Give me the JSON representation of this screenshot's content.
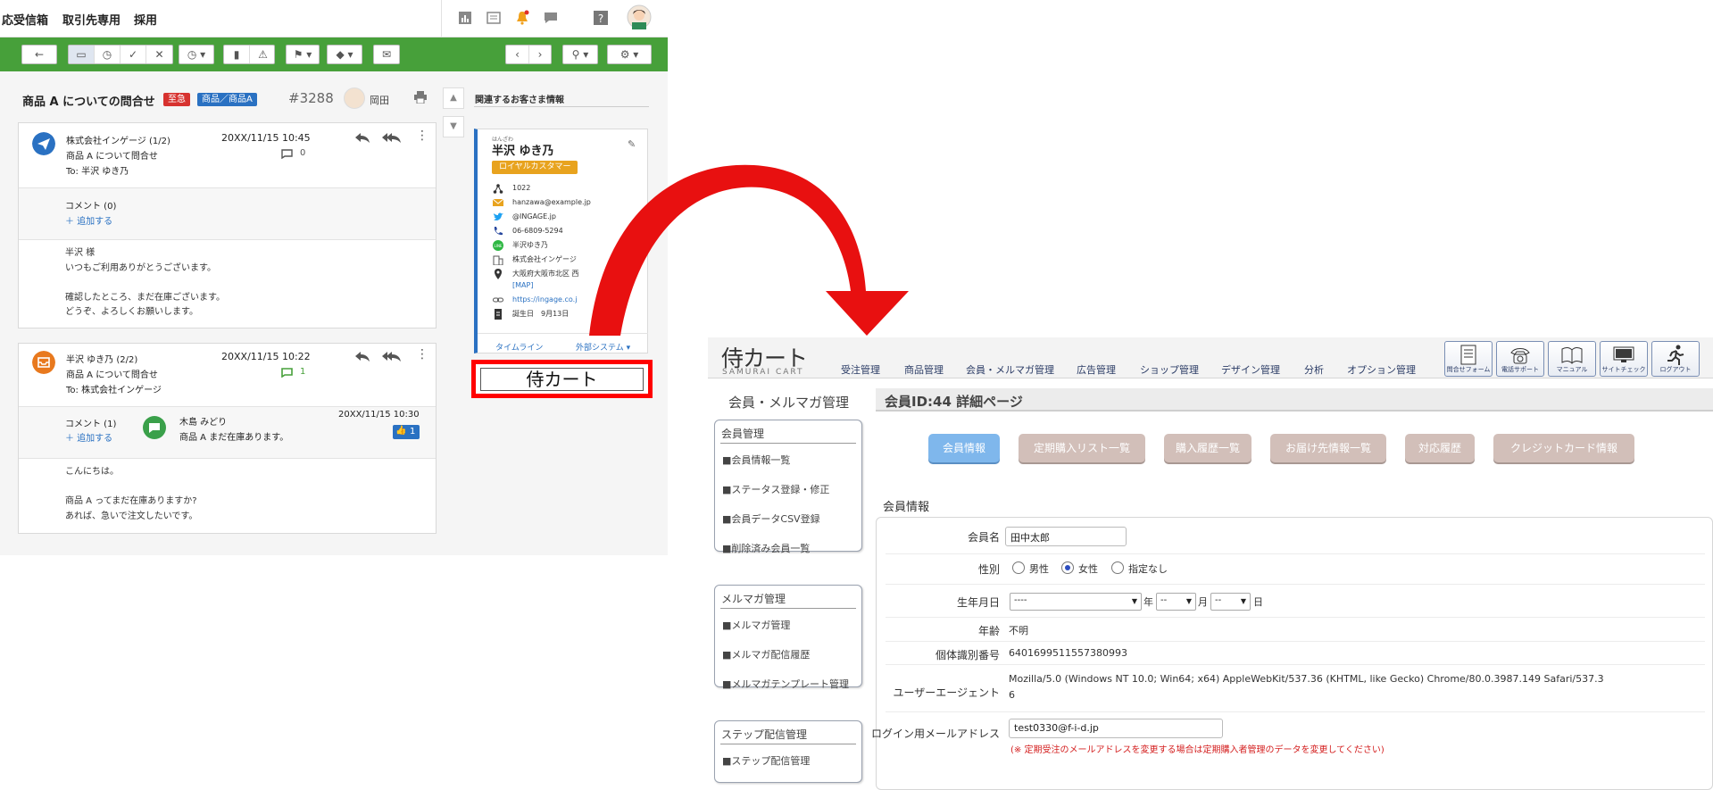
{
  "ingage": {
    "tabs": [
      "応受信箱",
      "取引先専用",
      "採用"
    ],
    "subject": "商品 A についての問合せ",
    "tags": [
      {
        "label": "至急",
        "color": "#d7322f"
      },
      {
        "label": "商品／商品A",
        "color": "#2a71c2"
      }
    ],
    "ticket_no": "#3288",
    "assignee": "岡田",
    "messages": [
      {
        "from": "株式会社インゲージ (1/2)",
        "subject": "商品 A について問合せ",
        "to": "To: 半沢 ゆき乃",
        "time": "20XX/11/15 10:45",
        "comment_count": "0",
        "comment_label": "コメント (0)",
        "add_label": "＋ 追加する",
        "body": "半沢 様\nいつもご利用ありがとうございます。\n\n確認したところ、まだ在庫ございます。\nどうぞ、よろしくお願いします。"
      },
      {
        "from": "半沢 ゆき乃 (2/2)",
        "subject": "商品 A について問合せ",
        "to": "To: 株式会社インゲージ",
        "time": "20XX/11/15 10:22",
        "comment_count": "1",
        "comment_label": "コメント (1)",
        "add_label": "＋ 追加する",
        "commenter": "木島 みどり",
        "comment_text": "商品 A まだ在庫あります。",
        "comment_time": "20XX/11/15 10:30",
        "like_count": "1",
        "body": "こんにちは。\n\n商品 A ってまだ在庫ありますか?\nあれば、急いで注文したいです。"
      }
    ],
    "related_title": "関連するお客さま情報",
    "customer": {
      "ruby": "はんざわ",
      "name": "半沢 ゆき乃",
      "badge": "ロイヤルカスタマー",
      "rows": [
        "1022",
        "hanzawa@example.jp",
        "@INGAGE.jp",
        "06-6809-5294",
        "半沢ゆき乃",
        "株式会社インゲージ",
        "大阪府大阪市北区 西",
        "[MAP]",
        "https://ingage.co.j",
        "誕生日　9月13日"
      ],
      "tab_timeline": "タイムライン",
      "tab_external": "外部システム ▾"
    },
    "samurai_link": "侍カート"
  },
  "samurai": {
    "logo": "侍カート",
    "logo_sub": "SAMURAI CART",
    "nav": [
      "受注管理",
      "商品管理",
      "会員・メルマガ管理",
      "広告管理",
      "ショップ管理",
      "デザイン管理",
      "分析",
      "オプション管理"
    ],
    "icon_buttons": [
      "問合せフォーム",
      "電話サポート",
      "マニュアル",
      "サイトチェック",
      "ログアウト"
    ],
    "side_title": "会員・メルマガ管理",
    "side_boxes": [
      {
        "title": "会員管理",
        "items": [
          "■会員情報一覧",
          "■ステータス登録・修正",
          "■会員データCSV登録",
          "■削除済み会員一覧"
        ]
      },
      {
        "title": "メルマガ管理",
        "items": [
          "■メルマガ管理",
          "■メルマガ配信履歴",
          "■メルマガテンプレート管理"
        ]
      },
      {
        "title": "ステップ配信管理",
        "items": [
          "■ステップ配信管理"
        ]
      }
    ],
    "page_title": "会員ID:44 詳細ページ",
    "tabs": [
      "会員情報",
      "定期購入リスト一覧",
      "購入履歴一覧",
      "お届け先情報一覧",
      "対応履歴",
      "クレジットカード情報"
    ],
    "section": "会員情報",
    "form": {
      "name_label": "会員名",
      "name_value": "田中太郎",
      "gender_label": "性別",
      "gender_options": [
        "男性",
        "女性",
        "指定なし"
      ],
      "birth_label": "生年月日",
      "birth_year": "----",
      "birth_month": "--",
      "birth_day": "--",
      "year_unit": "年",
      "month_unit": "月",
      "day_unit": "日",
      "age_label": "年齢",
      "age_value": "不明",
      "device_label": "個体識別番号",
      "device_value": "6401699511557380993",
      "ua_label": "ユーザーエージェント",
      "ua_line1": "Mozilla/5.0 (Windows NT 10.0; Win64; x64) AppleWebKit/537.36 (KHTML, like Gecko) Chrome/80.0.3987.149 Safari/537.3",
      "ua_line2": "6",
      "email_label": "ログイン用メールアドレス",
      "email_value": "test0330@f-i-d.jp",
      "email_warning": "(※ 定期受注のメールアドレスを変更する場合は定期購入者管理のデータを変更してください)"
    }
  },
  "colors": {
    "ingage_green": "#47a03a",
    "highlight_red": "#ff0000",
    "link_blue": "#2a71c2",
    "samurai_active_tab": "#7fb7ec",
    "samurai_tab": "#d2bfb9"
  }
}
